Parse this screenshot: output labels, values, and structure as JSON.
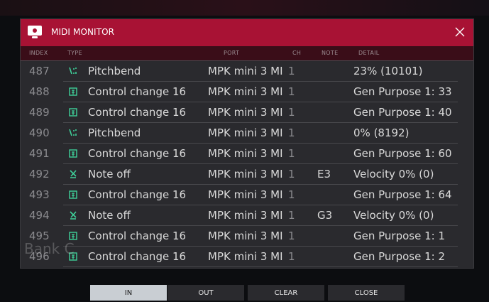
{
  "dialog": {
    "title": "MIDI MONITOR",
    "columns": {
      "index": "INDEX",
      "type": "TYPE",
      "port": "PORT",
      "ch": "CH",
      "note": "NOTE",
      "detail": "DETAIL"
    }
  },
  "background_text": "Bank C",
  "rows": [
    {
      "index": "487",
      "icon": "pitchbend-icon",
      "type": "Pitchbend",
      "port": "MPK mini 3 MI",
      "ch": "1",
      "note": "",
      "detail": "23% (10101)"
    },
    {
      "index": "488",
      "icon": "control-change-icon",
      "type": "Control change 16",
      "port": "MPK mini 3 MI",
      "ch": "1",
      "note": "",
      "detail": "Gen Purpose 1: 33"
    },
    {
      "index": "489",
      "icon": "control-change-icon",
      "type": "Control change 16",
      "port": "MPK mini 3 MI",
      "ch": "1",
      "note": "",
      "detail": "Gen Purpose 1: 40"
    },
    {
      "index": "490",
      "icon": "pitchbend-icon",
      "type": "Pitchbend",
      "port": "MPK mini 3 MI",
      "ch": "1",
      "note": "",
      "detail": "0% (8192)"
    },
    {
      "index": "491",
      "icon": "control-change-icon",
      "type": "Control change 16",
      "port": "MPK mini 3 MI",
      "ch": "1",
      "note": "",
      "detail": "Gen Purpose 1: 60"
    },
    {
      "index": "492",
      "icon": "note-off-icon",
      "type": "Note off",
      "port": "MPK mini 3 MI",
      "ch": "1",
      "note": "E3",
      "detail": "Velocity 0% (0)"
    },
    {
      "index": "493",
      "icon": "control-change-icon",
      "type": "Control change 16",
      "port": "MPK mini 3 MI",
      "ch": "1",
      "note": "",
      "detail": "Gen Purpose 1: 64"
    },
    {
      "index": "494",
      "icon": "note-off-icon",
      "type": "Note off",
      "port": "MPK mini 3 MI",
      "ch": "1",
      "note": "G3",
      "detail": "Velocity 0% (0)"
    },
    {
      "index": "495",
      "icon": "control-change-icon",
      "type": "Control change 16",
      "port": "MPK mini 3 MI",
      "ch": "1",
      "note": "",
      "detail": "Gen Purpose 1: 1"
    },
    {
      "index": "496",
      "icon": "control-change-icon",
      "type": "Control change 16",
      "port": "MPK mini 3 MI",
      "ch": "1",
      "note": "",
      "detail": "Gen Purpose 1: 2"
    }
  ],
  "buttons": {
    "in": "IN",
    "out": "OUT",
    "clear": "CLEAR",
    "close": "CLOSE"
  },
  "colors": {
    "title_bar": "#a81234",
    "header_row": "#3a0d18",
    "icon_green": "#3fd19a",
    "active_button": "#c9ced3"
  }
}
